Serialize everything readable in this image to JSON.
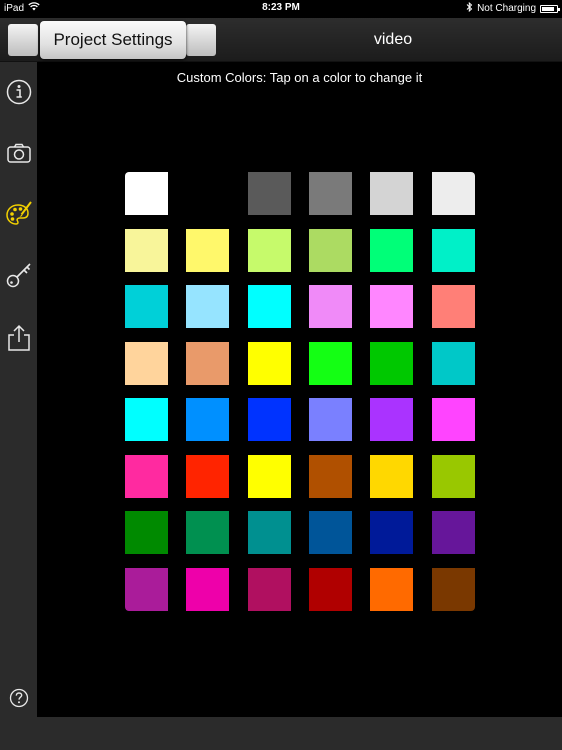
{
  "status_bar": {
    "device": "iPad",
    "time": "8:23 PM",
    "charging": "Not Charging",
    "battery_level": 0.85
  },
  "header": {
    "settings_button": "Project Settings",
    "title": "video"
  },
  "sidebar": {
    "items": [
      {
        "icon": "info-icon"
      },
      {
        "icon": "camera-icon"
      },
      {
        "icon": "palette-icon",
        "active": true
      },
      {
        "icon": "key-icon"
      },
      {
        "icon": "share-icon"
      },
      {
        "icon": "help-icon"
      }
    ]
  },
  "main": {
    "instruction": "Custom Colors: Tap on a color to change it"
  },
  "swatches": [
    [
      "#ffffff",
      null,
      "#5a5a5a",
      "#7a7a7a",
      "#d4d4d4",
      "#ededed"
    ],
    [
      "#f8f59a",
      "#fff86b",
      "#c6fa6b",
      "#acdb62",
      "#00ff78",
      "#00f0c8"
    ],
    [
      "#00d0d8",
      "#96e4ff",
      "#00ffff",
      "#f08af8",
      "#ff86ff",
      "#ff7f77"
    ],
    [
      "#ffd49c",
      "#e99a6a",
      "#ffff00",
      "#14ff14",
      "#00c800",
      "#00c8c8"
    ],
    [
      "#00ffff",
      "#0090ff",
      "#0033ff",
      "#7a80ff",
      "#aa33ff",
      "#ff44ff"
    ],
    [
      "#ff2aa0",
      "#ff2400",
      "#ffff00",
      "#b05000",
      "#ffd800",
      "#99c800"
    ],
    [
      "#008a00",
      "#009050",
      "#009090",
      "#005599",
      "#001a99",
      "#66169a"
    ],
    [
      "#aa1c9a",
      "#ee00aa",
      "#b01060",
      "#b00000",
      "#ff6a00",
      "#7a3800"
    ]
  ]
}
